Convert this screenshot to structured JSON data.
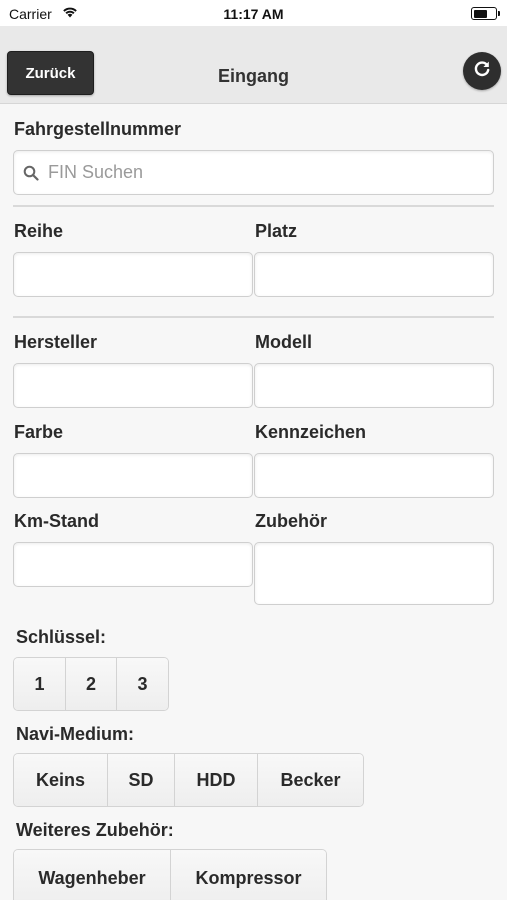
{
  "status_bar": {
    "carrier": "Carrier",
    "time": "11:17 AM"
  },
  "nav": {
    "back_label": "Zurück",
    "title": "Eingang",
    "refresh_icon": "refresh-icon"
  },
  "fin": {
    "label": "Fahrgestellnummer",
    "placeholder": "FIN Suchen"
  },
  "fields": {
    "reihe": "Reihe",
    "platz": "Platz",
    "hersteller": "Hersteller",
    "modell": "Modell",
    "farbe": "Farbe",
    "kennzeichen": "Kennzeichen",
    "km_stand": "Km-Stand",
    "zubehoer": "Zubehör"
  },
  "schluessel": {
    "label": "Schlüssel:",
    "options": [
      "1",
      "2",
      "3"
    ]
  },
  "navi": {
    "label": "Navi-Medium:",
    "options": [
      "Keins",
      "SD",
      "HDD",
      "Becker"
    ]
  },
  "weiteres": {
    "label": "Weiteres Zubehör:",
    "options": [
      "Wagenheber",
      "Kompressor"
    ]
  }
}
